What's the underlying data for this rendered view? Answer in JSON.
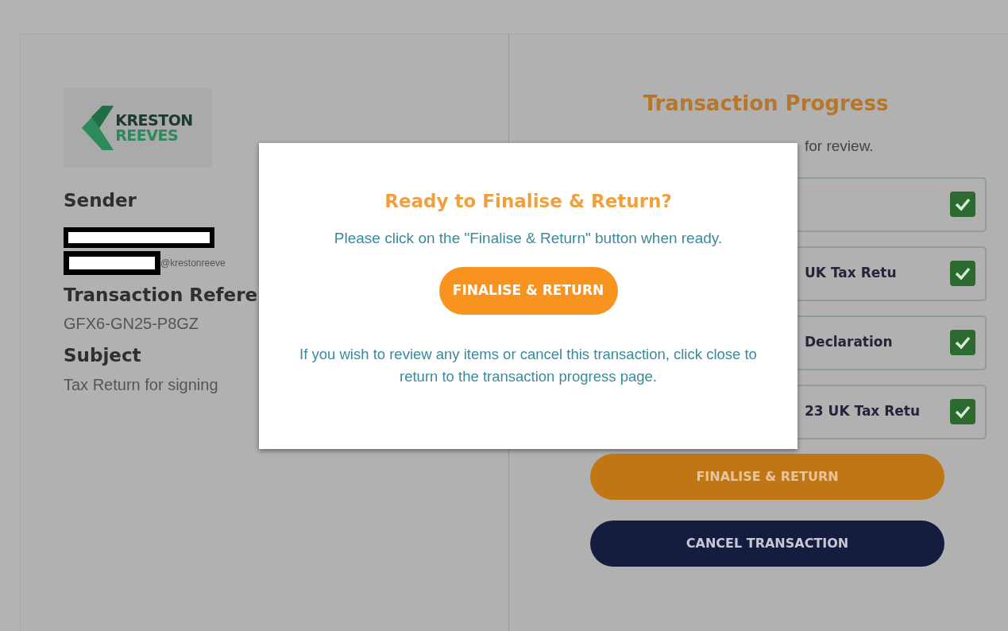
{
  "logo": {
    "lines": [
      "KRESTON",
      "REEVES"
    ]
  },
  "details": [
    {
      "kind": "heading",
      "text": "Sender"
    },
    {
      "kind": "redacted-email",
      "text": "@krestonreeve"
    },
    {
      "kind": "heading",
      "text": "Transaction Refere"
    },
    {
      "kind": "value",
      "text": "GFX6-GN25-P8GZ"
    },
    {
      "kind": "heading",
      "text": "Subject"
    },
    {
      "kind": "value",
      "text": "Tax Return for signing"
    }
  ],
  "progress": {
    "title": "Transaction Progress",
    "note": "for review.",
    "items": [
      {
        "checked": true
      },
      {
        "label": "UK Tax Retu",
        "checked": true
      },
      {
        "label": "Declaration",
        "checked": true
      },
      {
        "label": "23 UK Tax Retu",
        "checked": true
      }
    ],
    "buttons": [
      {
        "kind": "primary",
        "label": "FINALISE & RETURN"
      },
      {
        "kind": "dark",
        "label": "CANCEL TRANSACTION"
      }
    ]
  },
  "dialog": {
    "title": "Ready to Finalise & Return?",
    "message": "Please click on the \"Finalise & Return\" button when ready.",
    "button": "FINALISE & RETURN",
    "footer_before": "If you wish to review any items or cancel this transaction, click",
    "footer_link": "close",
    "footer_after": "to return to the transaction progress page."
  }
}
